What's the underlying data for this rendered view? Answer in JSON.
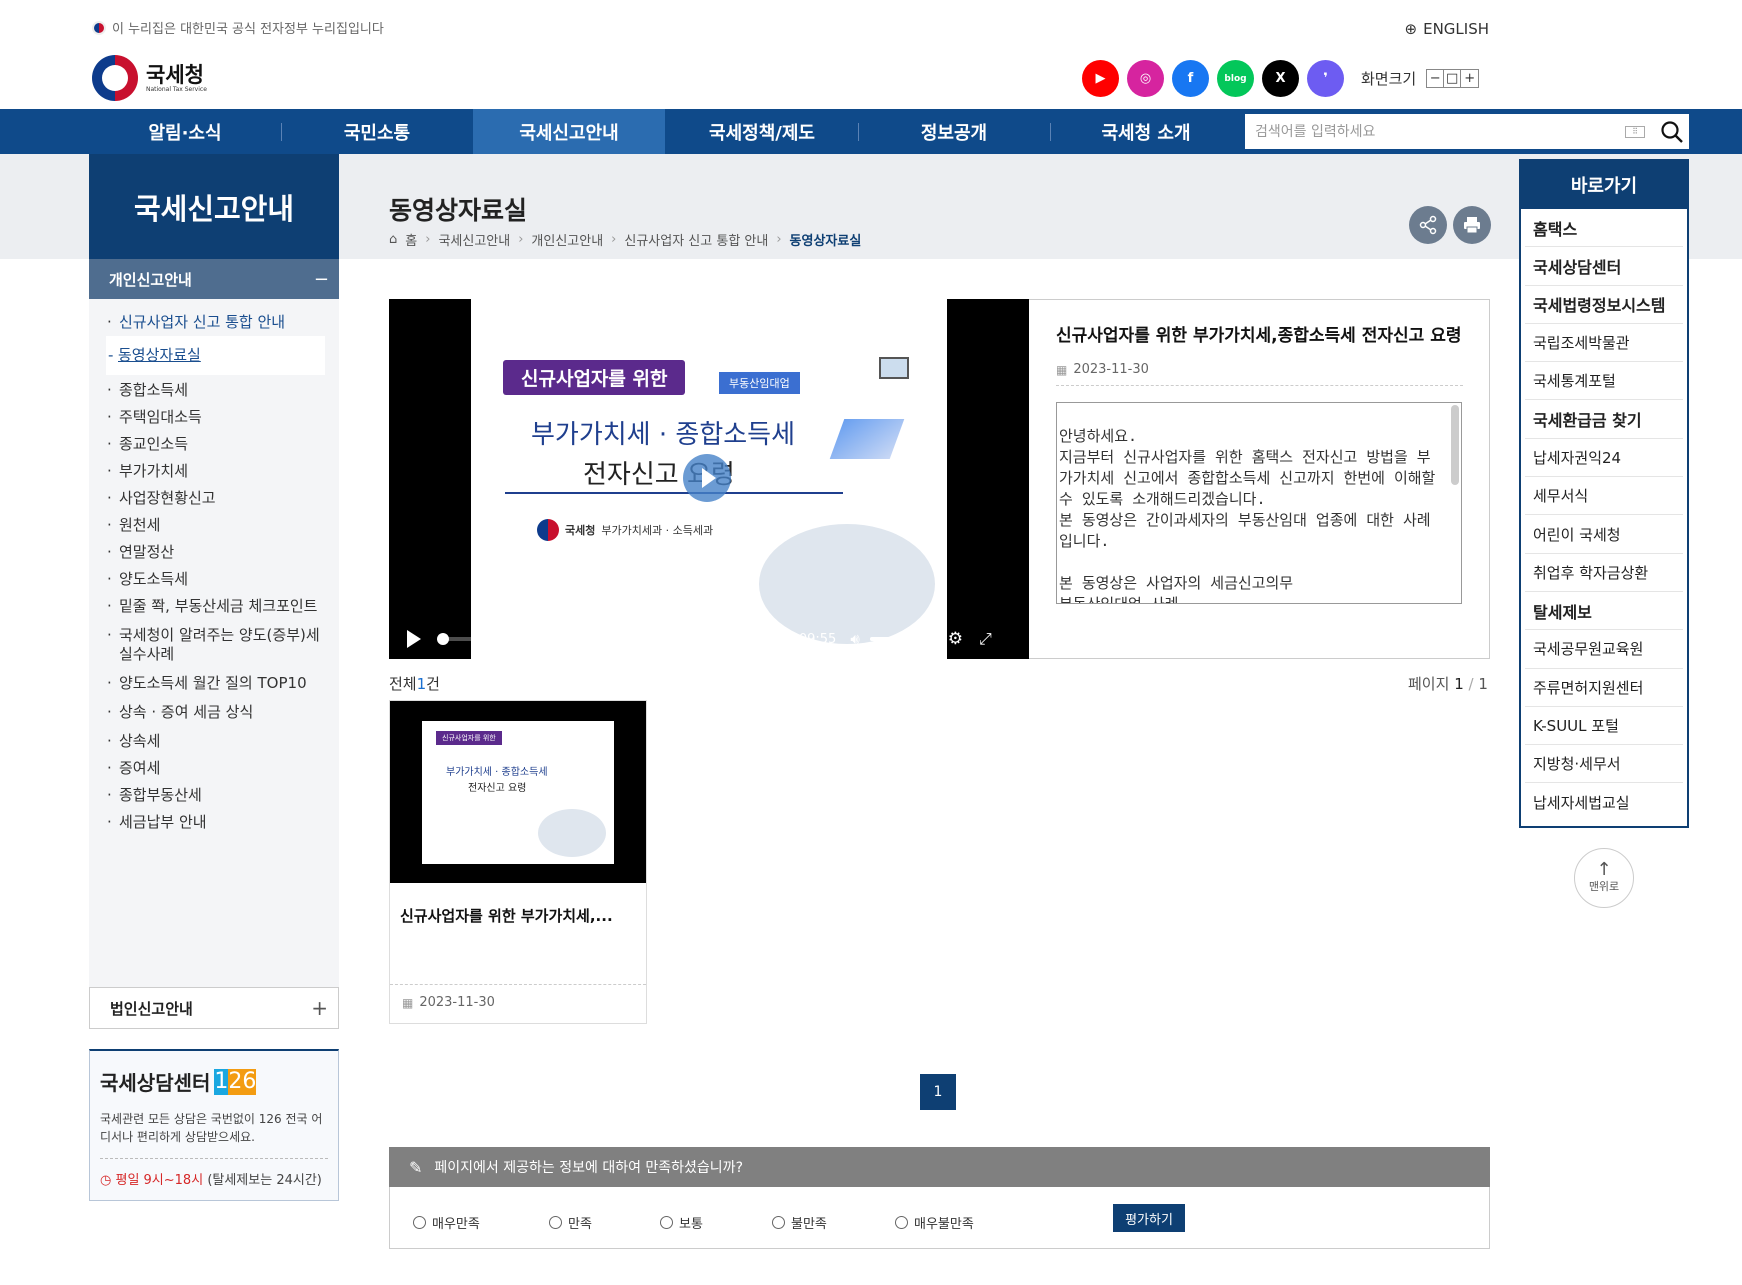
{
  "gov_bar": {
    "text": "이 누리집은 대한민국 공식 전자정부 누리집입니다"
  },
  "lang": {
    "label": "ENGLISH"
  },
  "logo": {
    "name_ko": "국세청",
    "name_en": "National Tax Service"
  },
  "social": [
    {
      "name": "youtube",
      "color": "#ff0000",
      "glyph": "▶"
    },
    {
      "name": "instagram",
      "color": "#d6249f",
      "glyph": "◎"
    },
    {
      "name": "facebook",
      "color": "#1877f2",
      "glyph": "f"
    },
    {
      "name": "blog",
      "color": "#03c75a",
      "glyph": "blog"
    },
    {
      "name": "x",
      "color": "#000000",
      "glyph": "X"
    },
    {
      "name": "kakao-story",
      "color": "#6d5cf2",
      "glyph": "❜"
    }
  ],
  "font_size": {
    "label": "화면크기",
    "minus": "−",
    "reset": "□",
    "plus": "+"
  },
  "nav": {
    "items": [
      "알림·소식",
      "국민소통",
      "국세신고안내",
      "국세정책/제도",
      "정보공개",
      "국세청 소개"
    ],
    "active_index": 2
  },
  "search": {
    "placeholder": "검색어를 입력하세요"
  },
  "lnb": {
    "title": "국세신고안내",
    "section": "개인신고안내",
    "section_toggle": "−",
    "items": [
      "신규사업자 신고 통합 안내",
      "동영상자료실",
      "종합소득세",
      "주택임대소득",
      "종교인소득",
      "부가가치세",
      "사업장현황신고",
      "원천세",
      "연말정산",
      "양도소득세",
      "밑줄 쫙, 부동산세금 체크포인트",
      "국세청이 알려주는 양도(증부)세 실수사례",
      "양도소득세 월간 질의 TOP10",
      "상속 · 증여 세금 상식",
      "상속세",
      "증여세",
      "종합부동산세",
      "세금납부 안내"
    ],
    "active_index": 1,
    "corp_section": "법인신고안내",
    "corp_toggle": "+"
  },
  "counsel": {
    "title": "국세상담센터",
    "number": [
      "1",
      "2",
      "6"
    ],
    "desc": "국세관련 모든 상담은 국번없이 126 전국 어디서나 편리하게 상담받으세요.",
    "time_hl": "평일 9시~18시",
    "time_rest": "(탈세제보는 24시간)"
  },
  "page": {
    "title": "동영상자료실",
    "breadcrumb": [
      "홈",
      "국세신고안내",
      "개인신고안내",
      "신규사업자 신고 통합 안내",
      "동영상자료실"
    ]
  },
  "video": {
    "slide_badge": "신규사업자를 위한",
    "slide_tag": "부동산임대업",
    "slide_line1": "부가가치세 · 종합소득세",
    "slide_line2": "전자신고 요령",
    "slide_org": "국세청",
    "slide_dept": "부가가치세과 · 소득세과",
    "current_time": "00:00",
    "duration": "09:55",
    "time_sep": "/",
    "progress": 0,
    "volume": 1.0,
    "title": "신규사업자를 위한 부가가치세,종합소득세 전자신고 요령",
    "date": "2023-11-30",
    "description": "안녕하세요.\n지금부터 신규사업자를 위한 홈택스 전자신고 방법을 부가가치세 신고에서 종합합소득세 신고까지 한번에 이해할 수 있도록 소개해드리겠습니다.\n본 동영상은 간이과세자의 부동산임대 업종에 대한 사례입니다.\n\n본 동영상은 사업자의 세금신고의무\n부동산임대업 사례\n홈택스 로그인 방법"
  },
  "list": {
    "total_label": "전체",
    "total_count": "1",
    "total_unit": "건",
    "page_label": "페이지",
    "page_current": "1",
    "page_sep": "/",
    "page_total": "1",
    "cards": [
      {
        "title": "신규사업자를 위한 부가가치세,...",
        "date": "2023-11-30",
        "mini_badge": "신규사업자를 위한",
        "mini_l1": "부가가치세 · 종합소득세",
        "mini_l2": "전자신고 요령"
      }
    ],
    "pager": [
      "1"
    ]
  },
  "survey": {
    "question": "페이지에서 제공하는 정보에 대하여 만족하셨습니까?",
    "options": [
      "매우만족",
      "만족",
      "보통",
      "불만족",
      "매우불만족"
    ],
    "submit": "평가하기"
  },
  "quick": {
    "title": "바로가기",
    "items": [
      {
        "label": "홈택스",
        "strong": true
      },
      {
        "label": "국세상담센터",
        "strong": true
      },
      {
        "label": "국세법령정보시스템",
        "strong": true
      },
      {
        "label": "국립조세박물관",
        "strong": false
      },
      {
        "label": "국세통계포털",
        "strong": false
      },
      {
        "label": "국세환급금 찾기",
        "strong": true
      },
      {
        "label": "납세자권익24",
        "strong": false
      },
      {
        "label": "세무서식",
        "strong": false
      },
      {
        "label": "어린이 국세청",
        "strong": false
      },
      {
        "label": "취업후 학자금상환",
        "strong": false
      },
      {
        "label": "탈세제보",
        "strong": true
      },
      {
        "label": "국세공무원교육원",
        "strong": false
      },
      {
        "label": "주류면허지원센터",
        "strong": false
      },
      {
        "label": "K-SUUL 포털",
        "strong": false
      },
      {
        "label": "지방청·세무서",
        "strong": false
      },
      {
        "label": "납세자세법교실",
        "strong": false
      }
    ],
    "top_label": "맨위로"
  }
}
